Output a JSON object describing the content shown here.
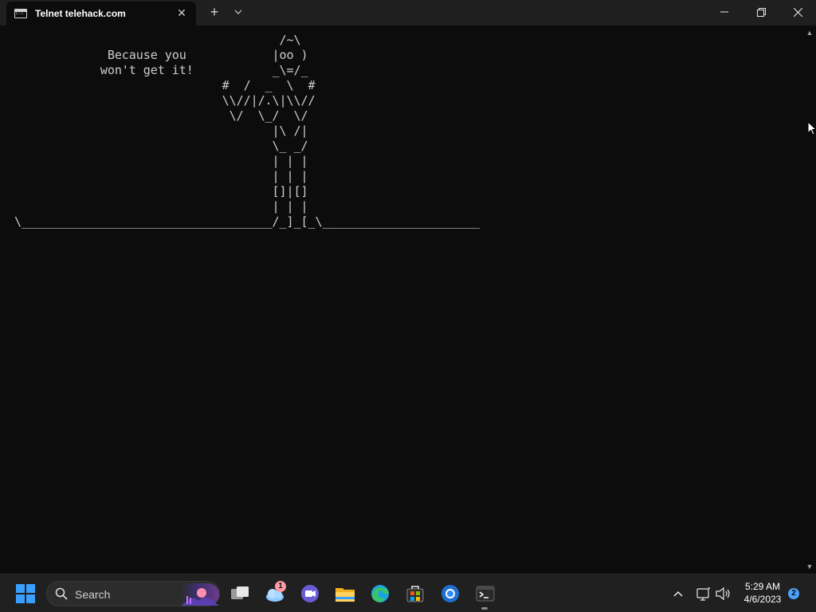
{
  "window": {
    "tab_title": "Telnet telehack.com",
    "tab_close_glyph": "✕",
    "new_tab_glyph": "+",
    "dropdown_glyph": "⌄",
    "minimize_glyph": "—",
    "maximize_glyph": "❐",
    "close_glyph": "✕"
  },
  "terminal": {
    "ascii_art": "                                     /~\\\n             Because you            |oo )\n            won't get it!           _\\=/_\n                             #  /  _  \\  #\n                             \\\\//|/.\\|\\\\//\n                              \\/  \\_/  \\/\n                                    |\\ /|\n                                    \\_ _/\n                                    | | |\n                                    | | |\n                                    []|[]\n                                    | | |\n\\___________________________________/_]_[_\\______________________",
    "scroll_up_glyph": "▲",
    "scroll_down_glyph": "▼"
  },
  "taskbar": {
    "search_label": "Search",
    "weather_badge": "1",
    "clock_time": "5:29 AM",
    "clock_date": "4/6/2023",
    "notification_count": "2",
    "tray_chevron_glyph": "^"
  }
}
